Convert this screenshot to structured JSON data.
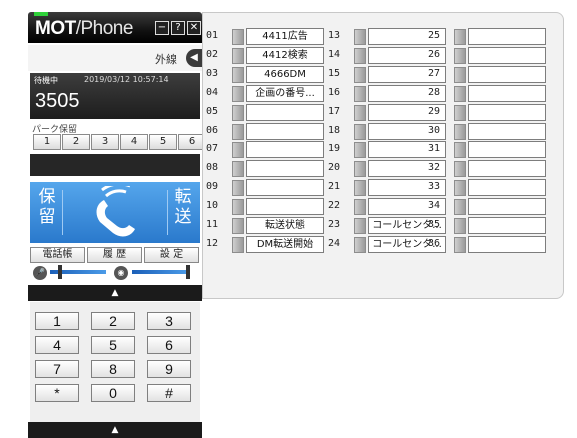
{
  "app": {
    "logo_bold": "MOT",
    "logo_thin": "/Phone"
  },
  "window_buttons": {
    "minimize": "−",
    "help": "?",
    "close": "✕"
  },
  "outline": {
    "label": "外線",
    "arrow": "◀"
  },
  "status": {
    "state": "待機中",
    "datetime": "2019/03/12  10:57:14",
    "number": "3505"
  },
  "park": {
    "label": "パーク保留",
    "slots": [
      "1",
      "2",
      "3",
      "4",
      "5",
      "6"
    ]
  },
  "actions": {
    "hold": [
      "保",
      "留"
    ],
    "transfer": [
      "転",
      "送"
    ]
  },
  "tabs": [
    "電話帳",
    "履 歴",
    "設 定"
  ],
  "volume": {
    "mic_icon": "mic-icon",
    "speaker_icon": "speaker-icon",
    "mic_level": 0.5,
    "speaker_level": 0.8
  },
  "expander_arrow": "▲",
  "keypad": [
    "1",
    "2",
    "3",
    "4",
    "5",
    "6",
    "7",
    "8",
    "9",
    "*",
    "0",
    "#"
  ],
  "lines": [
    {
      "n": "01",
      "label": "4411広告"
    },
    {
      "n": "02",
      "label": "4412検索"
    },
    {
      "n": "03",
      "label": "4666DM"
    },
    {
      "n": "04",
      "label": "企画の番号..."
    },
    {
      "n": "05",
      "label": ""
    },
    {
      "n": "06",
      "label": ""
    },
    {
      "n": "07",
      "label": ""
    },
    {
      "n": "08",
      "label": ""
    },
    {
      "n": "09",
      "label": ""
    },
    {
      "n": "10",
      "label": ""
    },
    {
      "n": "11",
      "label": "転送状態"
    },
    {
      "n": "12",
      "label": "DM転送開始"
    },
    {
      "n": "13",
      "label": ""
    },
    {
      "n": "14",
      "label": ""
    },
    {
      "n": "15",
      "label": ""
    },
    {
      "n": "16",
      "label": ""
    },
    {
      "n": "17",
      "label": ""
    },
    {
      "n": "18",
      "label": ""
    },
    {
      "n": "19",
      "label": ""
    },
    {
      "n": "20",
      "label": ""
    },
    {
      "n": "21",
      "label": ""
    },
    {
      "n": "22",
      "label": ""
    },
    {
      "n": "23",
      "label": "コールセンタ..."
    },
    {
      "n": "24",
      "label": "コールセンタ..."
    },
    {
      "n": "25",
      "label": ""
    },
    {
      "n": "26",
      "label": ""
    },
    {
      "n": "27",
      "label": ""
    },
    {
      "n": "28",
      "label": ""
    },
    {
      "n": "29",
      "label": ""
    },
    {
      "n": "30",
      "label": ""
    },
    {
      "n": "31",
      "label": ""
    },
    {
      "n": "32",
      "label": ""
    },
    {
      "n": "33",
      "label": ""
    },
    {
      "n": "34",
      "label": ""
    },
    {
      "n": "35",
      "label": ""
    },
    {
      "n": "36",
      "label": ""
    }
  ],
  "colors": {
    "accent_blue": "#3a8de0",
    "led_green": "#2fd13a",
    "dark": "#1b1b1b"
  }
}
